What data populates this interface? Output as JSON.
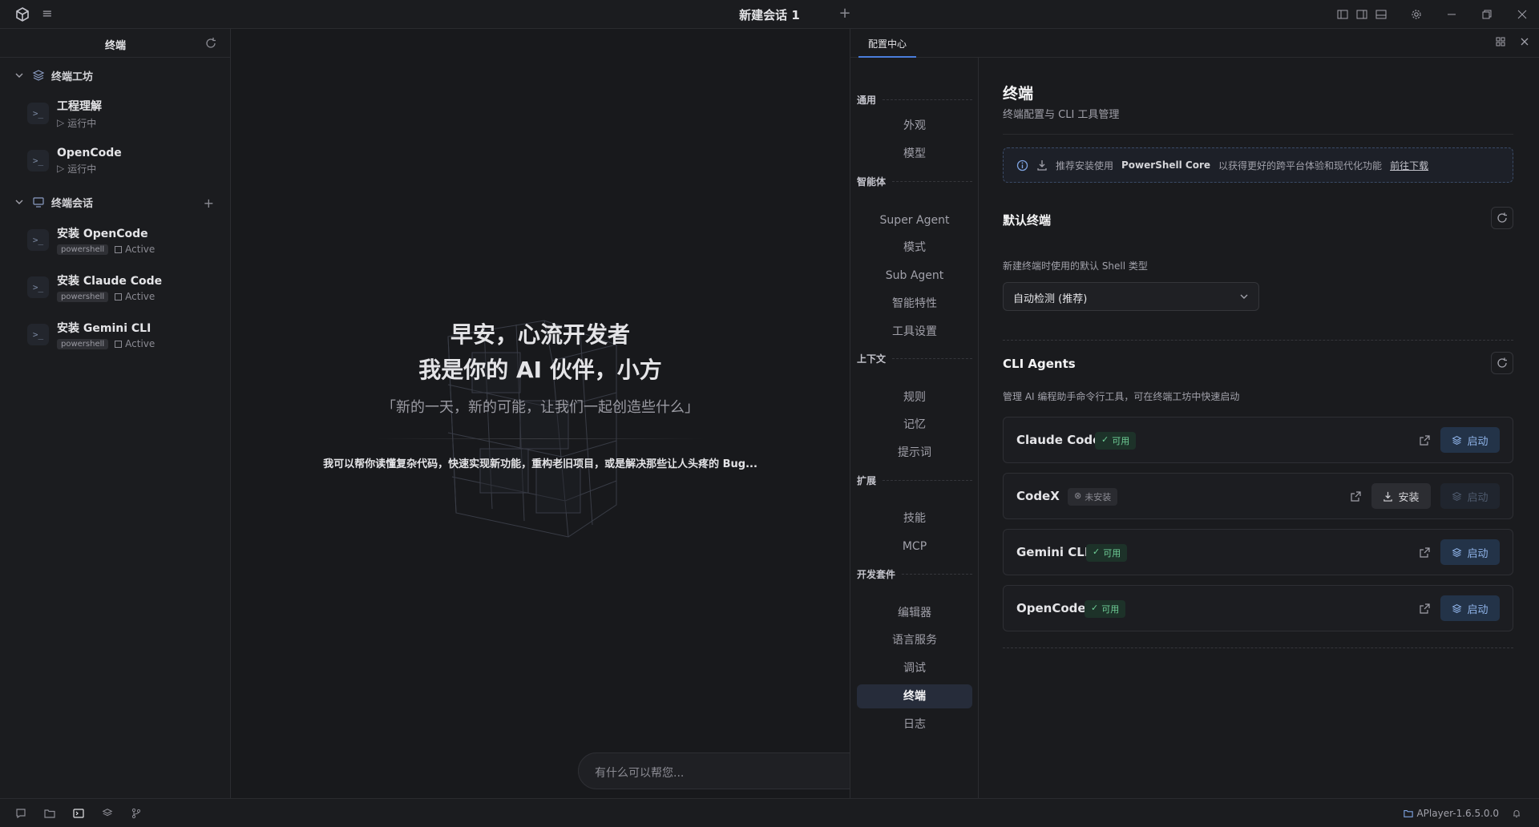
{
  "titlebar": {
    "title": "新建会话 1"
  },
  "left": {
    "header": "终端",
    "workshop": {
      "label": "终端工坊",
      "items": [
        {
          "name": "工程理解",
          "status": "运行中"
        },
        {
          "name": "OpenCode",
          "status": "运行中"
        }
      ]
    },
    "sessions": {
      "label": "终端会话",
      "items": [
        {
          "name": "安装 OpenCode",
          "shell": "powershell",
          "state": "Active"
        },
        {
          "name": "安装 Claude Code",
          "shell": "powershell",
          "state": "Active"
        },
        {
          "name": "安装 Gemini CLI",
          "shell": "powershell",
          "state": "Active"
        }
      ]
    }
  },
  "center": {
    "greeting": "早安，心流开发者",
    "intro": "我是你的 AI 伙伴，小方",
    "quote": "「新的一天，新的可能，让我们一起创造些什么」",
    "desc": "我可以帮你读懂复杂代码，快速实现新功能，重构老旧项目，或是解决那些让人头疼的 Bug...",
    "input_placeholder": "有什么可以帮您..."
  },
  "config": {
    "tab": "配置中心",
    "nav": {
      "sections": [
        {
          "title": "通用",
          "items": [
            "外观",
            "模型"
          ]
        },
        {
          "title": "智能体",
          "items": [
            "Super Agent",
            "模式",
            "Sub Agent",
            "智能特性",
            "工具设置"
          ]
        },
        {
          "title": "上下文",
          "items": [
            "规则",
            "记忆",
            "提示词"
          ]
        },
        {
          "title": "扩展",
          "items": [
            "技能",
            "MCP"
          ]
        },
        {
          "title": "开发套件",
          "items": [
            "编辑器",
            "语言服务",
            "调试",
            "终端",
            "日志"
          ]
        }
      ],
      "selected": "终端"
    },
    "main": {
      "title": "终端",
      "subtitle": "终端配置与 CLI 工具管理",
      "notice": {
        "prefix": "推荐安装使用",
        "product": "PowerShell Core",
        "suffix": "以获得更好的跨平台体验和现代化功能",
        "link": "前往下载"
      },
      "default_terminal": {
        "title": "默认终端",
        "desc": "新建终端时使用的默认 Shell 类型",
        "selected": "自动检测 (推荐)"
      },
      "cli_agents": {
        "title": "CLI Agents",
        "desc": "管理 AI 编程助手命令行工具，可在终端工坊中快速启动",
        "agents": [
          {
            "name": "Claude Code",
            "status": "可用",
            "launch": "启动"
          },
          {
            "name": "CodeX",
            "status": "未安装",
            "install": "安装",
            "launch": "启动"
          },
          {
            "name": "Gemini CLI",
            "status": "可用",
            "launch": "启动"
          },
          {
            "name": "OpenCode",
            "status": "可用",
            "launch": "启动"
          }
        ]
      }
    }
  },
  "statusbar": {
    "app_version": "APlayer-1.6.5.0.0"
  },
  "colors": {
    "accent": "#4a7ddb",
    "ok": "#6fcf97",
    "launch_bg": "#233348"
  }
}
